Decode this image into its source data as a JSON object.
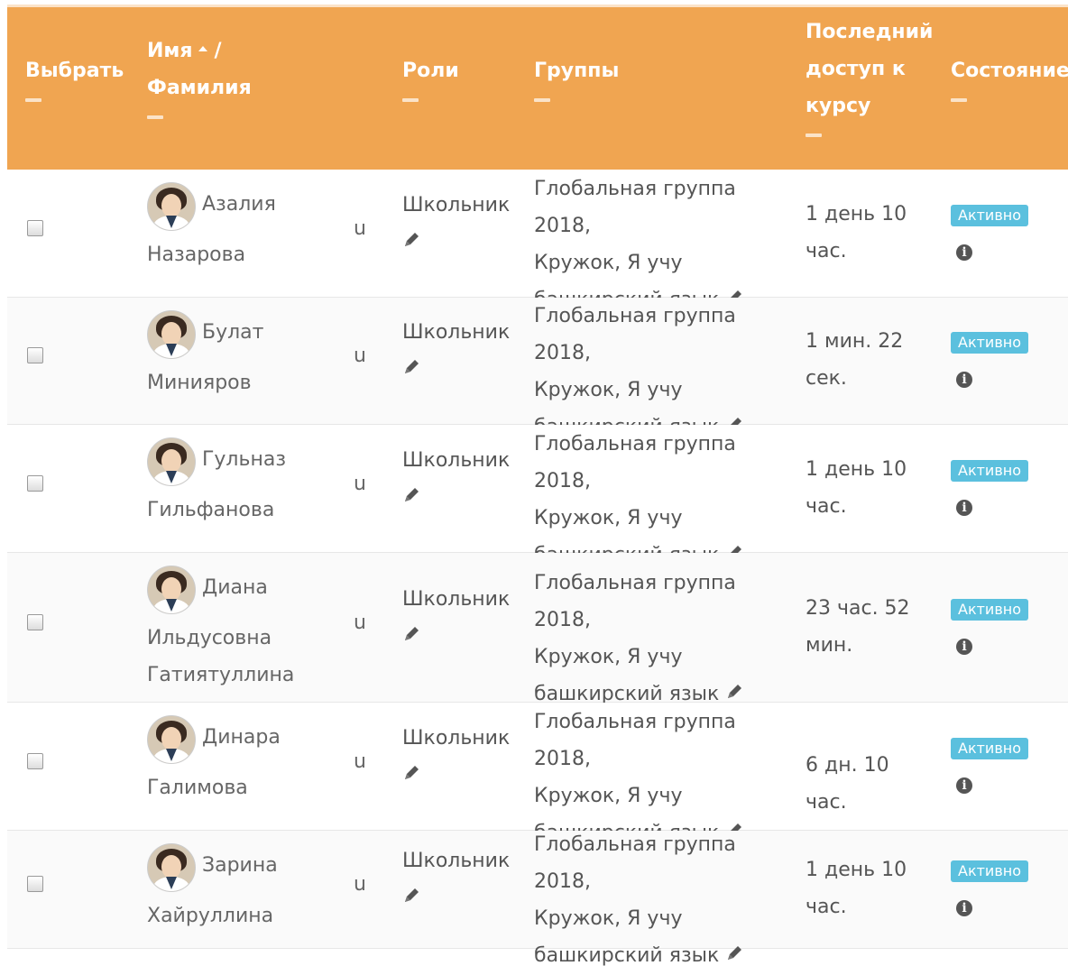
{
  "header": {
    "select": "Выбрать",
    "name_first": "Имя",
    "name_sep": "/",
    "name_last": "Фамилия",
    "roles": "Роли",
    "groups": "Группы",
    "last_access_1": "Последний",
    "last_access_2": "доступ к",
    "last_access_3": "курсу",
    "status": "Состояние"
  },
  "colors": {
    "header_bg": "#f0a551",
    "badge": "#5bc0de"
  },
  "rows": [
    {
      "first": "Азалия",
      "rest": [
        "Назарова"
      ],
      "col_u": "u",
      "role": "Школьник",
      "groups": [
        "Глобальная группа 2018,",
        "Кружок, Я учу",
        "башкирский язык"
      ],
      "access": [
        "1 день 10",
        "час."
      ],
      "status": "Активно"
    },
    {
      "first": "Булат",
      "rest": [
        "Минияров"
      ],
      "col_u": "u",
      "role": "Школьник",
      "groups": [
        "Глобальная группа 2018,",
        "Кружок, Я учу",
        "башкирский язык"
      ],
      "access": [
        "1 мин. 22",
        "сек."
      ],
      "status": "Активно"
    },
    {
      "first": "Гульназ",
      "rest": [
        "Гильфанова"
      ],
      "col_u": "u",
      "role": "Школьник",
      "groups": [
        "Глобальная группа 2018,",
        "Кружок, Я учу",
        "башкирский язык"
      ],
      "access": [
        "1 день 10",
        "час."
      ],
      "status": "Активно"
    },
    {
      "first": "Диана",
      "rest": [
        "Ильдусовна",
        "Гатиятуллина"
      ],
      "col_u": "u",
      "role": "Школьник",
      "groups": [
        "Глобальная группа 2018,",
        "Кружок, Я учу",
        "башкирский язык"
      ],
      "access": [
        "23 час. 52",
        "мин."
      ],
      "status": "Активно"
    },
    {
      "first": "Динара",
      "rest": [
        "Галимова"
      ],
      "col_u": "u",
      "role": "Школьник",
      "groups": [
        "Глобальная группа 2018,",
        "Кружок, Я учу",
        "башкирский язык"
      ],
      "access": [
        "6 дн. 10 час."
      ],
      "status": "Активно"
    },
    {
      "first": "Зарина",
      "rest": [
        "Хайруллина"
      ],
      "col_u": "u",
      "role": "Школьник",
      "groups": [
        "Глобальная группа 2018,",
        "Кружок, Я учу",
        "башкирский язык"
      ],
      "access": [
        "1 день 10",
        "час."
      ],
      "status": "Активно"
    }
  ]
}
